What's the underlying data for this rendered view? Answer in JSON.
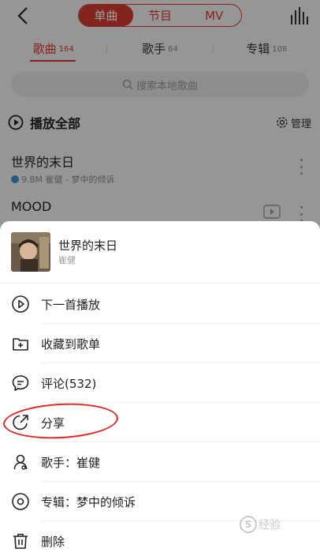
{
  "top": {
    "segments": [
      "单曲",
      "节目",
      "MV"
    ],
    "active_segment": 0
  },
  "subtabs": [
    {
      "label": "歌曲",
      "count": "164"
    },
    {
      "label": "歌手",
      "count": "64"
    },
    {
      "label": "专辑",
      "count": "108"
    }
  ],
  "search": {
    "placeholder": "搜索本地歌曲"
  },
  "list": {
    "play_all": "播放全部",
    "manage": "管理",
    "songs": [
      {
        "title": "世界的末日",
        "sub": "9.8M 崔健 - 梦中的倾诉"
      },
      {
        "title": "MOOD",
        "sub": ""
      }
    ]
  },
  "sheet": {
    "song_title": "世界的末日",
    "artist": "崔健",
    "actions": [
      {
        "icon": "play-next-icon",
        "label": "下一首播放"
      },
      {
        "icon": "add-to-playlist-icon",
        "label": "收藏到歌单"
      },
      {
        "icon": "comment-icon",
        "label": "评论(532)"
      },
      {
        "icon": "share-icon",
        "label": "分享"
      },
      {
        "icon": "singer-icon",
        "label": "歌手：崔健"
      },
      {
        "icon": "album-icon",
        "label": "专辑：梦中的倾诉"
      },
      {
        "icon": "delete-icon",
        "label": "删除"
      }
    ]
  },
  "watermark": {
    "text": "经验"
  },
  "colors": {
    "accent": "#d33a31",
    "highlight_circle": "#e0271f"
  }
}
